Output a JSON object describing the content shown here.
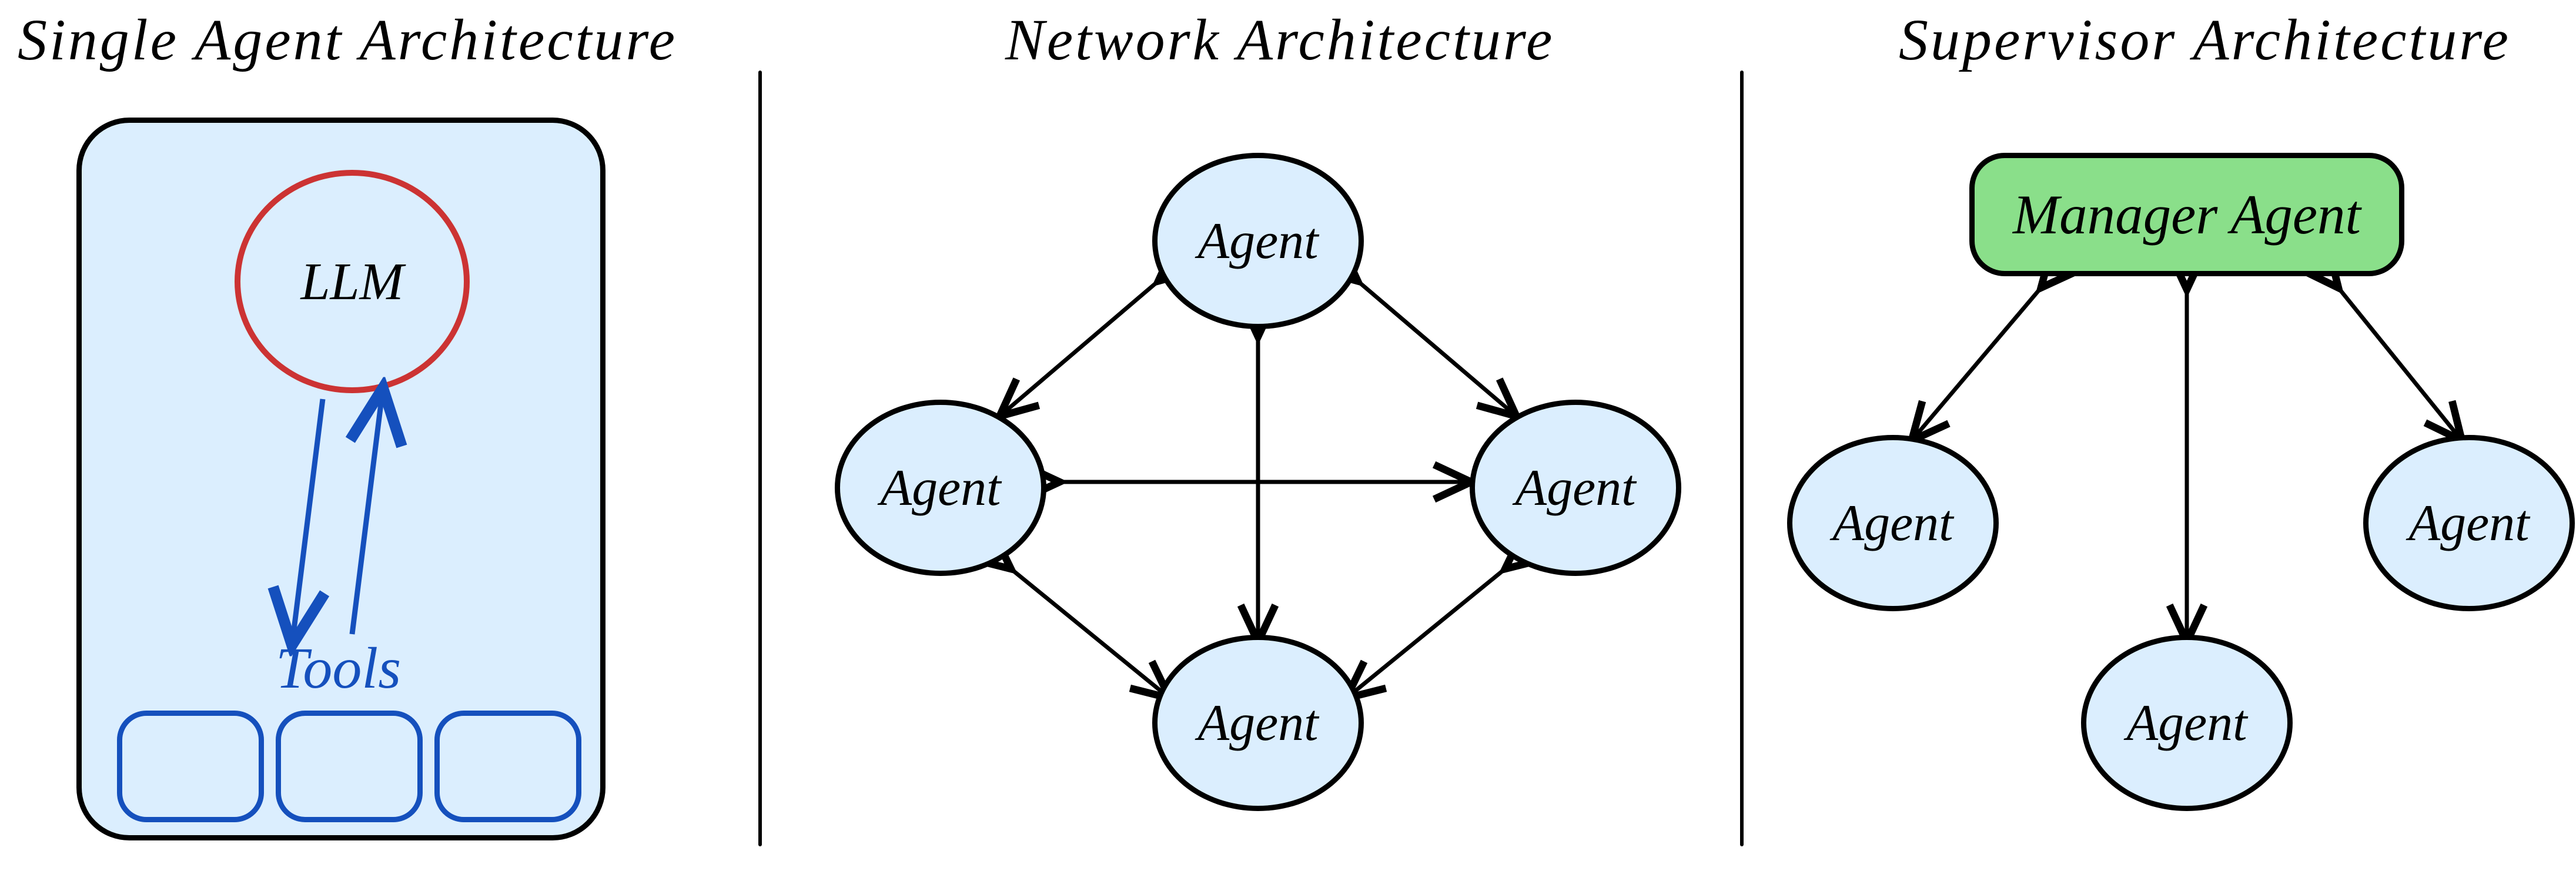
{
  "single": {
    "title": "Single Agent Architecture",
    "llm_label": "LLM",
    "tools_label": "Tools"
  },
  "network": {
    "title": "Network Architecture",
    "agent_label": "Agent"
  },
  "supervisor": {
    "title": "Supervisor Architecture",
    "manager_label": "Manager Agent",
    "agent_label": "Agent"
  },
  "chart_data": {
    "type": "diagram",
    "panels": [
      {
        "name": "Single Agent Architecture",
        "nodes": [
          {
            "id": "llm",
            "label": "LLM",
            "kind": "llm"
          },
          {
            "id": "tools",
            "label": "Tools",
            "kind": "tool-group",
            "count": 3
          }
        ],
        "edges": [
          {
            "from": "llm",
            "to": "tools",
            "bidirectional": true
          }
        ]
      },
      {
        "name": "Network Architecture",
        "nodes": [
          {
            "id": "a1",
            "label": "Agent",
            "kind": "agent"
          },
          {
            "id": "a2",
            "label": "Agent",
            "kind": "agent"
          },
          {
            "id": "a3",
            "label": "Agent",
            "kind": "agent"
          },
          {
            "id": "a4",
            "label": "Agent",
            "kind": "agent"
          }
        ],
        "edges": [
          {
            "from": "a1",
            "to": "a2",
            "bidirectional": true
          },
          {
            "from": "a1",
            "to": "a3",
            "bidirectional": true
          },
          {
            "from": "a1",
            "to": "a4",
            "bidirectional": true
          },
          {
            "from": "a2",
            "to": "a3",
            "bidirectional": true
          },
          {
            "from": "a2",
            "to": "a4",
            "bidirectional": true
          },
          {
            "from": "a3",
            "to": "a4",
            "bidirectional": true
          }
        ],
        "note": "fully-connected 4-agent mesh"
      },
      {
        "name": "Supervisor Architecture",
        "nodes": [
          {
            "id": "mgr",
            "label": "Manager Agent",
            "kind": "manager"
          },
          {
            "id": "s1",
            "label": "Agent",
            "kind": "agent"
          },
          {
            "id": "s2",
            "label": "Agent",
            "kind": "agent"
          },
          {
            "id": "s3",
            "label": "Agent",
            "kind": "agent"
          }
        ],
        "edges": [
          {
            "from": "mgr",
            "to": "s1",
            "bidirectional": true
          },
          {
            "from": "mgr",
            "to": "s2",
            "bidirectional": true
          },
          {
            "from": "mgr",
            "to": "s3",
            "bidirectional": true
          }
        ]
      }
    ]
  }
}
